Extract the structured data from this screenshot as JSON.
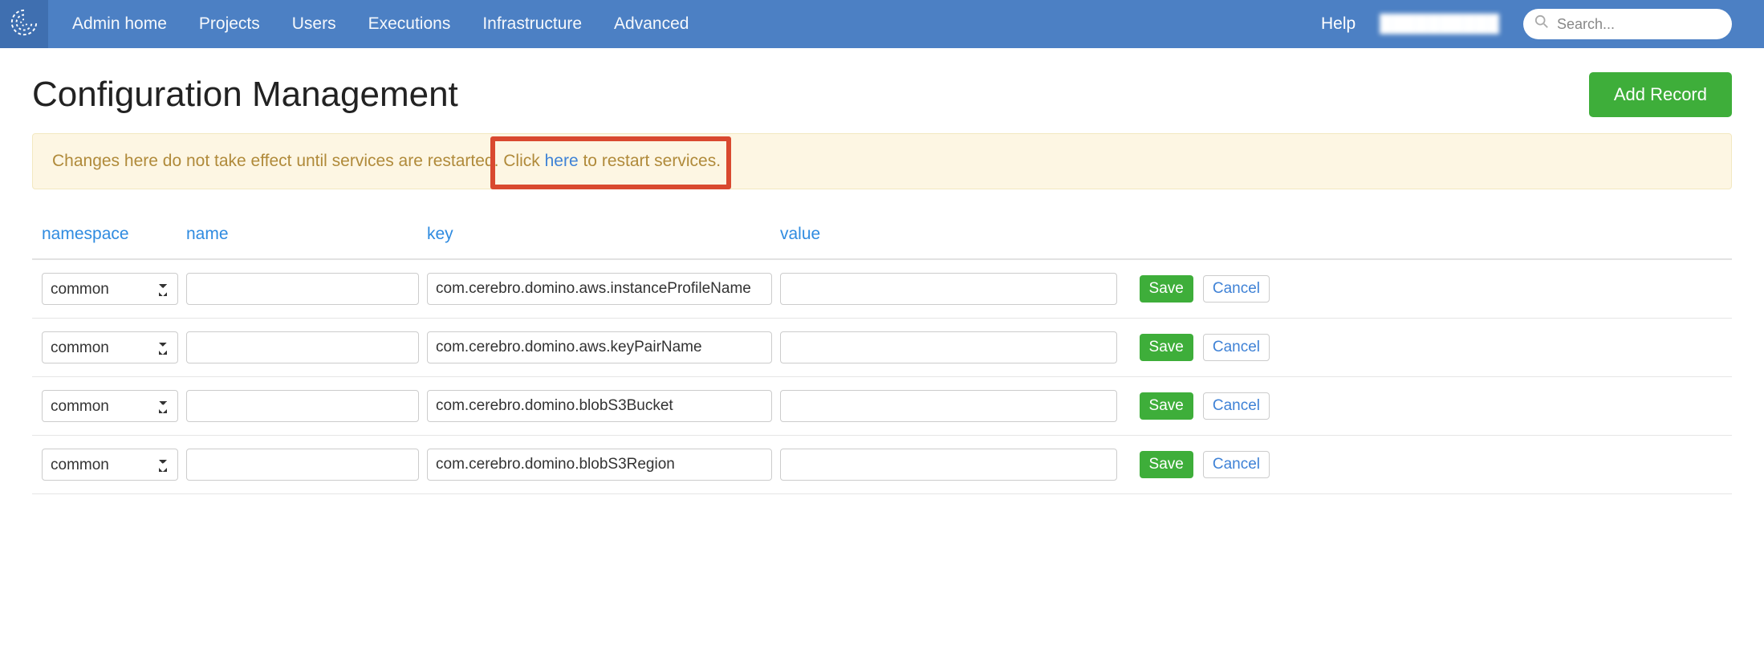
{
  "nav": {
    "items": [
      "Admin home",
      "Projects",
      "Users",
      "Executions",
      "Infrastructure",
      "Advanced"
    ],
    "help": "Help",
    "user": "██████████",
    "search_placeholder": "Search..."
  },
  "page": {
    "title": "Configuration Management",
    "add_record": "Add Record"
  },
  "alert": {
    "pre": "Changes here do not take effect until services are restarted. ",
    "click": "Click ",
    "link": "here",
    "post": " to restart services."
  },
  "table": {
    "headers": {
      "namespace": "namespace",
      "name": "name",
      "key": "key",
      "value": "value"
    },
    "namespace_options": [
      "common"
    ],
    "save_label": "Save",
    "cancel_label": "Cancel",
    "rows": [
      {
        "namespace": "common",
        "name": "",
        "key": "com.cerebro.domino.aws.instanceProfileName",
        "value": ""
      },
      {
        "namespace": "common",
        "name": "",
        "key": "com.cerebro.domino.aws.keyPairName",
        "value": ""
      },
      {
        "namespace": "common",
        "name": "",
        "key": "com.cerebro.domino.blobS3Bucket",
        "value": ""
      },
      {
        "namespace": "common",
        "name": "",
        "key": "com.cerebro.domino.blobS3Region",
        "value": ""
      }
    ]
  }
}
